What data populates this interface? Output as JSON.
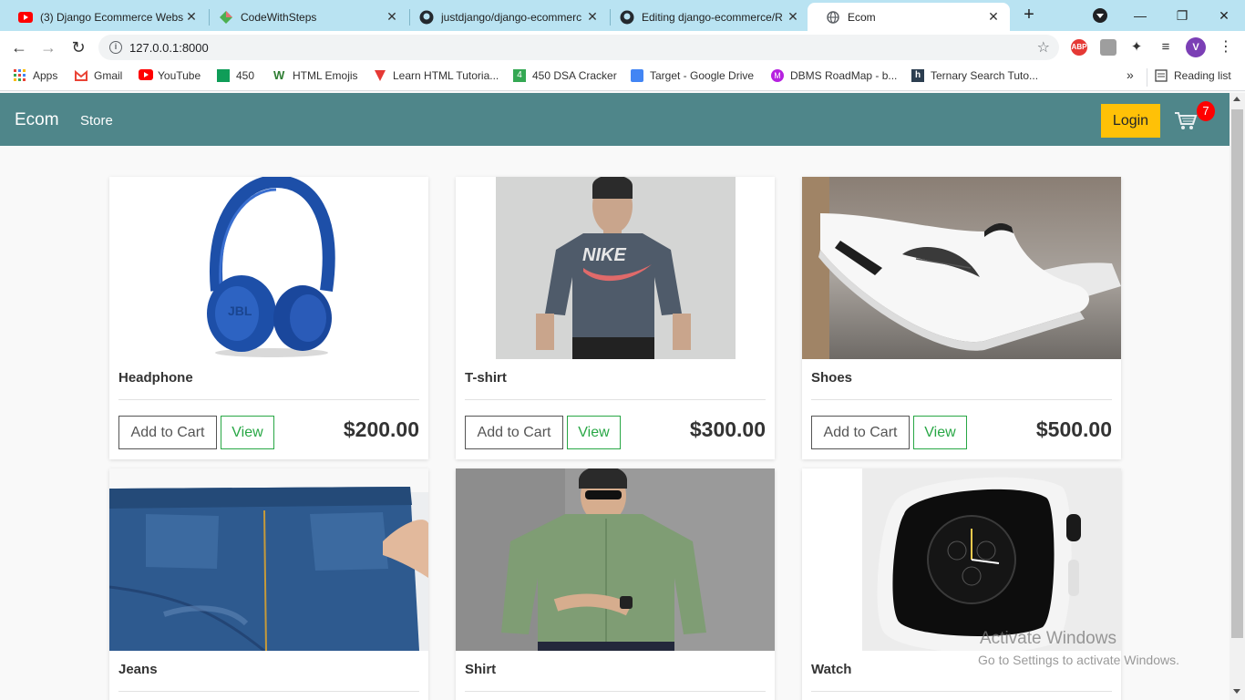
{
  "browser": {
    "tabs": [
      {
        "title": "(3) Django Ecommerce Webs",
        "icon": "youtube-icon"
      },
      {
        "title": "CodeWithSteps",
        "icon": "codewithsteps-icon"
      },
      {
        "title": "justdjango/django-ecommerc",
        "icon": "github-icon"
      },
      {
        "title": "Editing django-ecommerce/R",
        "icon": "github-icon"
      },
      {
        "title": "Ecom",
        "icon": "globe-icon"
      }
    ],
    "url": "127.0.0.1:8000",
    "profile_initial": "V",
    "adblock_label": "ABP",
    "bookmarks": [
      {
        "label": "Apps"
      },
      {
        "label": "Gmail"
      },
      {
        "label": "YouTube"
      },
      {
        "label": "450"
      },
      {
        "label": "HTML Emojis"
      },
      {
        "label": "Learn HTML Tutoria..."
      },
      {
        "label": "450 DSA Cracker"
      },
      {
        "label": "Target - Google Drive"
      },
      {
        "label": "DBMS RoadMap - b..."
      },
      {
        "label": "Ternary Search Tuto..."
      }
    ],
    "bookmarks_overflow": "»",
    "reading_list": "Reading list"
  },
  "site": {
    "brand": "Ecom",
    "nav_store": "Store",
    "login": "Login",
    "cart_count": "7",
    "colors": {
      "navbar": "#4f868a",
      "login": "#ffc107",
      "badge": "#ff0000",
      "view": "#28a745"
    }
  },
  "products": [
    {
      "name": "Headphone",
      "add_label": "Add to Cart",
      "view_label": "View",
      "price": "$200.00"
    },
    {
      "name": "T-shirt",
      "add_label": "Add to Cart",
      "view_label": "View",
      "price": "$300.00"
    },
    {
      "name": "Shoes",
      "add_label": "Add to Cart",
      "view_label": "View",
      "price": "$500.00"
    },
    {
      "name": "Jeans"
    },
    {
      "name": "Shirt"
    },
    {
      "name": "Watch"
    }
  ],
  "watermark": {
    "line1": "Activate Windows",
    "line2": "Go to Settings to activate Windows."
  }
}
